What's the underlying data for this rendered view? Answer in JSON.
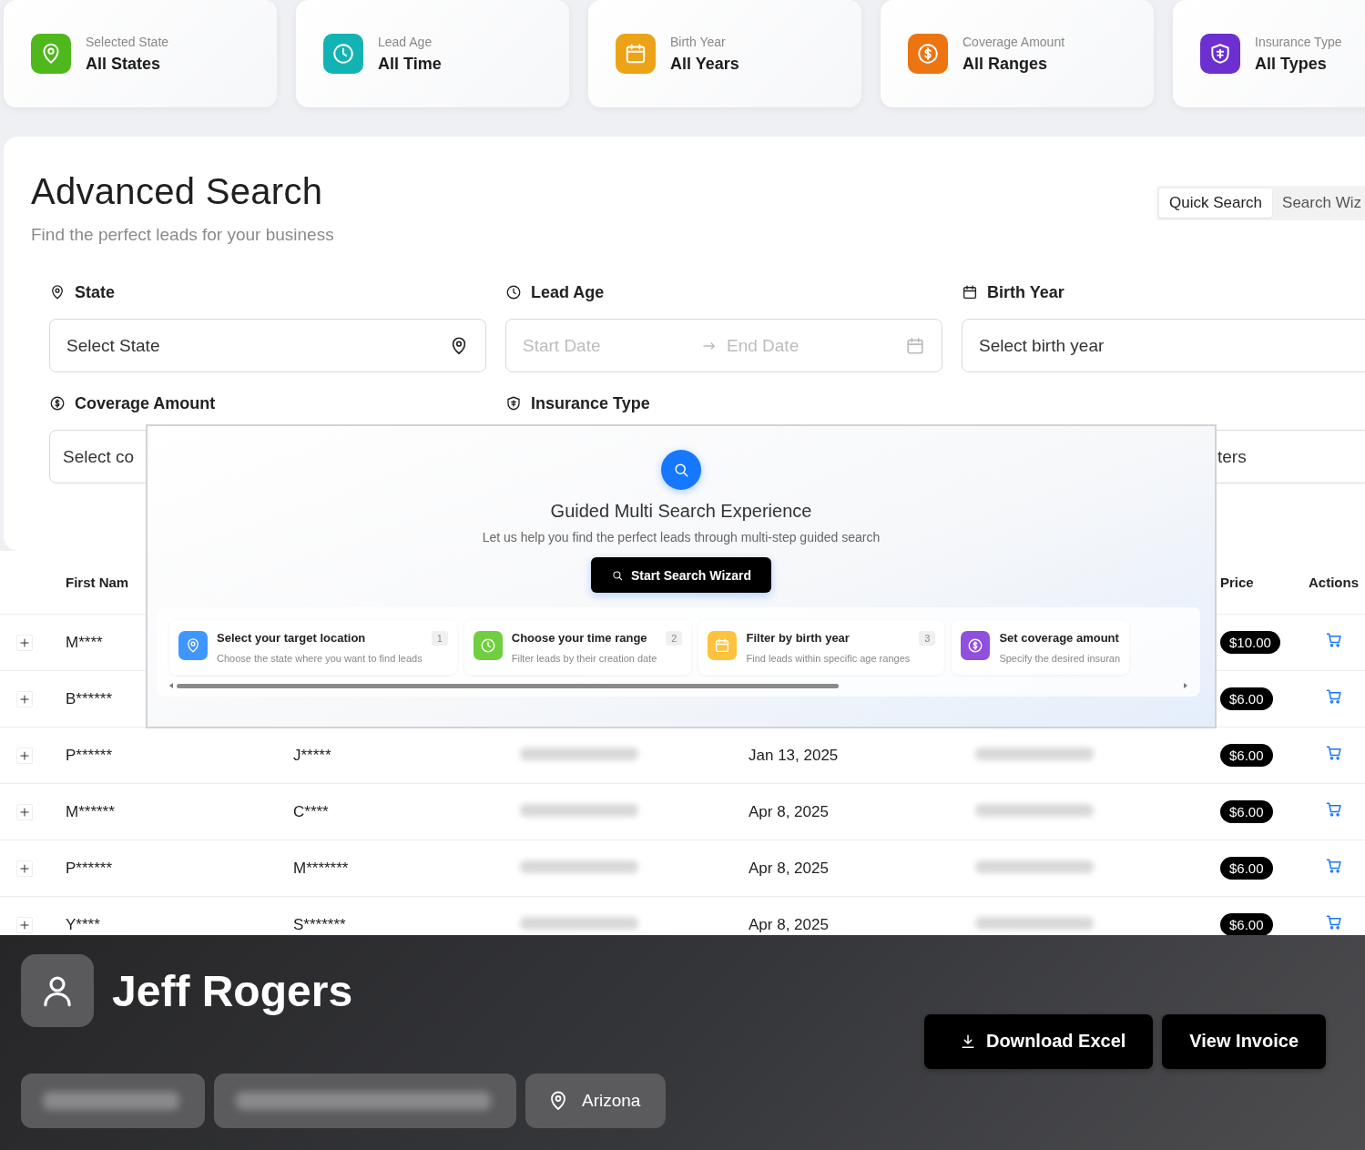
{
  "stat_cards": [
    {
      "kind": "location",
      "label": "Selected State",
      "value": "All States",
      "color": "#4fb81c"
    },
    {
      "kind": "clock",
      "label": "Lead Age",
      "value": "All Time",
      "color": "#13b3b3"
    },
    {
      "kind": "calendar",
      "label": "Birth Year",
      "value": "All Years",
      "color": "#eda317"
    },
    {
      "kind": "dollar",
      "label": "Coverage Amount",
      "value": "All Ranges",
      "color": "#ec7411"
    },
    {
      "kind": "shield",
      "label": "Insurance Type",
      "value": "All Types",
      "color": "#6d2fcf"
    }
  ],
  "search_panel": {
    "title": "Advanced Search",
    "subtitle": "Find the perfect leads for your business",
    "tabs": [
      {
        "label": "Quick Search",
        "selected": true
      },
      {
        "label": "Search Wiz",
        "selected": false
      }
    ],
    "fields": [
      {
        "kind": "state",
        "label": "State",
        "placeholder": "Select State"
      },
      {
        "kind": "lead-age",
        "label": "Lead Age",
        "start_placeholder": "Start Date",
        "end_placeholder": "End Date"
      },
      {
        "kind": "birth-year",
        "label": "Birth Year",
        "placeholder": "Select birth year"
      },
      {
        "kind": "coverage",
        "label": "Coverage Amount",
        "placeholder": "Select co"
      },
      {
        "kind": "insurance",
        "label": "Insurance Type"
      },
      {
        "kind": "covered",
        "placeholder": "ters"
      }
    ]
  },
  "table": {
    "columns": {
      "first_name": "First Nam",
      "price": "Price",
      "actions": "Actions"
    },
    "rows": [
      {
        "first_name": "M****",
        "price": "$10.00"
      },
      {
        "first_name": "B******",
        "price": "$6.00"
      },
      {
        "first_name": "P******",
        "last_name": "J*****",
        "masked": true,
        "date": "Jan 13, 2025",
        "price": "$6.00"
      },
      {
        "first_name": "M******",
        "last_name": "C****",
        "masked": true,
        "date": "Apr 8, 2025",
        "price": "$6.00"
      },
      {
        "first_name": "P******",
        "last_name": "M*******",
        "masked": true,
        "date": "Apr 8, 2025",
        "price": "$6.00"
      },
      {
        "first_name": "Y****",
        "last_name": "S*******",
        "masked": true,
        "date": "Apr 8, 2025",
        "price": "$6.00"
      }
    ]
  },
  "wizard": {
    "title": "Guided Multi Search Experience",
    "subtitle": "Let us help you find the perfect leads through multi-step guided search",
    "button": "Start Search Wizard",
    "steps": [
      {
        "kind": "location",
        "title": "Select your target location",
        "description": "Choose the state where you want to find leads",
        "number": "1",
        "color": "#4096ff"
      },
      {
        "kind": "clock",
        "title": "Choose your time range",
        "description": "Filter leads by their creation date",
        "number": "2",
        "color": "#6fcf3f"
      },
      {
        "kind": "calendar",
        "title": "Filter by birth year",
        "description": "Find leads within specific age ranges",
        "number": "3",
        "color": "#ffc23d"
      },
      {
        "kind": "dollar",
        "title": "Set coverage amount",
        "description": "Specify the desired insuran",
        "color": "#8f50db"
      }
    ]
  },
  "profile": {
    "name": "Jeff Rogers",
    "contacts": [
      {
        "kind": "phone",
        "blurred": true
      },
      {
        "kind": "email",
        "blurred": true
      },
      {
        "kind": "location",
        "value": "Arizona",
        "blurred": false
      }
    ],
    "buttons": [
      {
        "kind": "download",
        "label": "Download Excel"
      },
      {
        "kind": "plain",
        "label": "View Invoice"
      }
    ]
  }
}
